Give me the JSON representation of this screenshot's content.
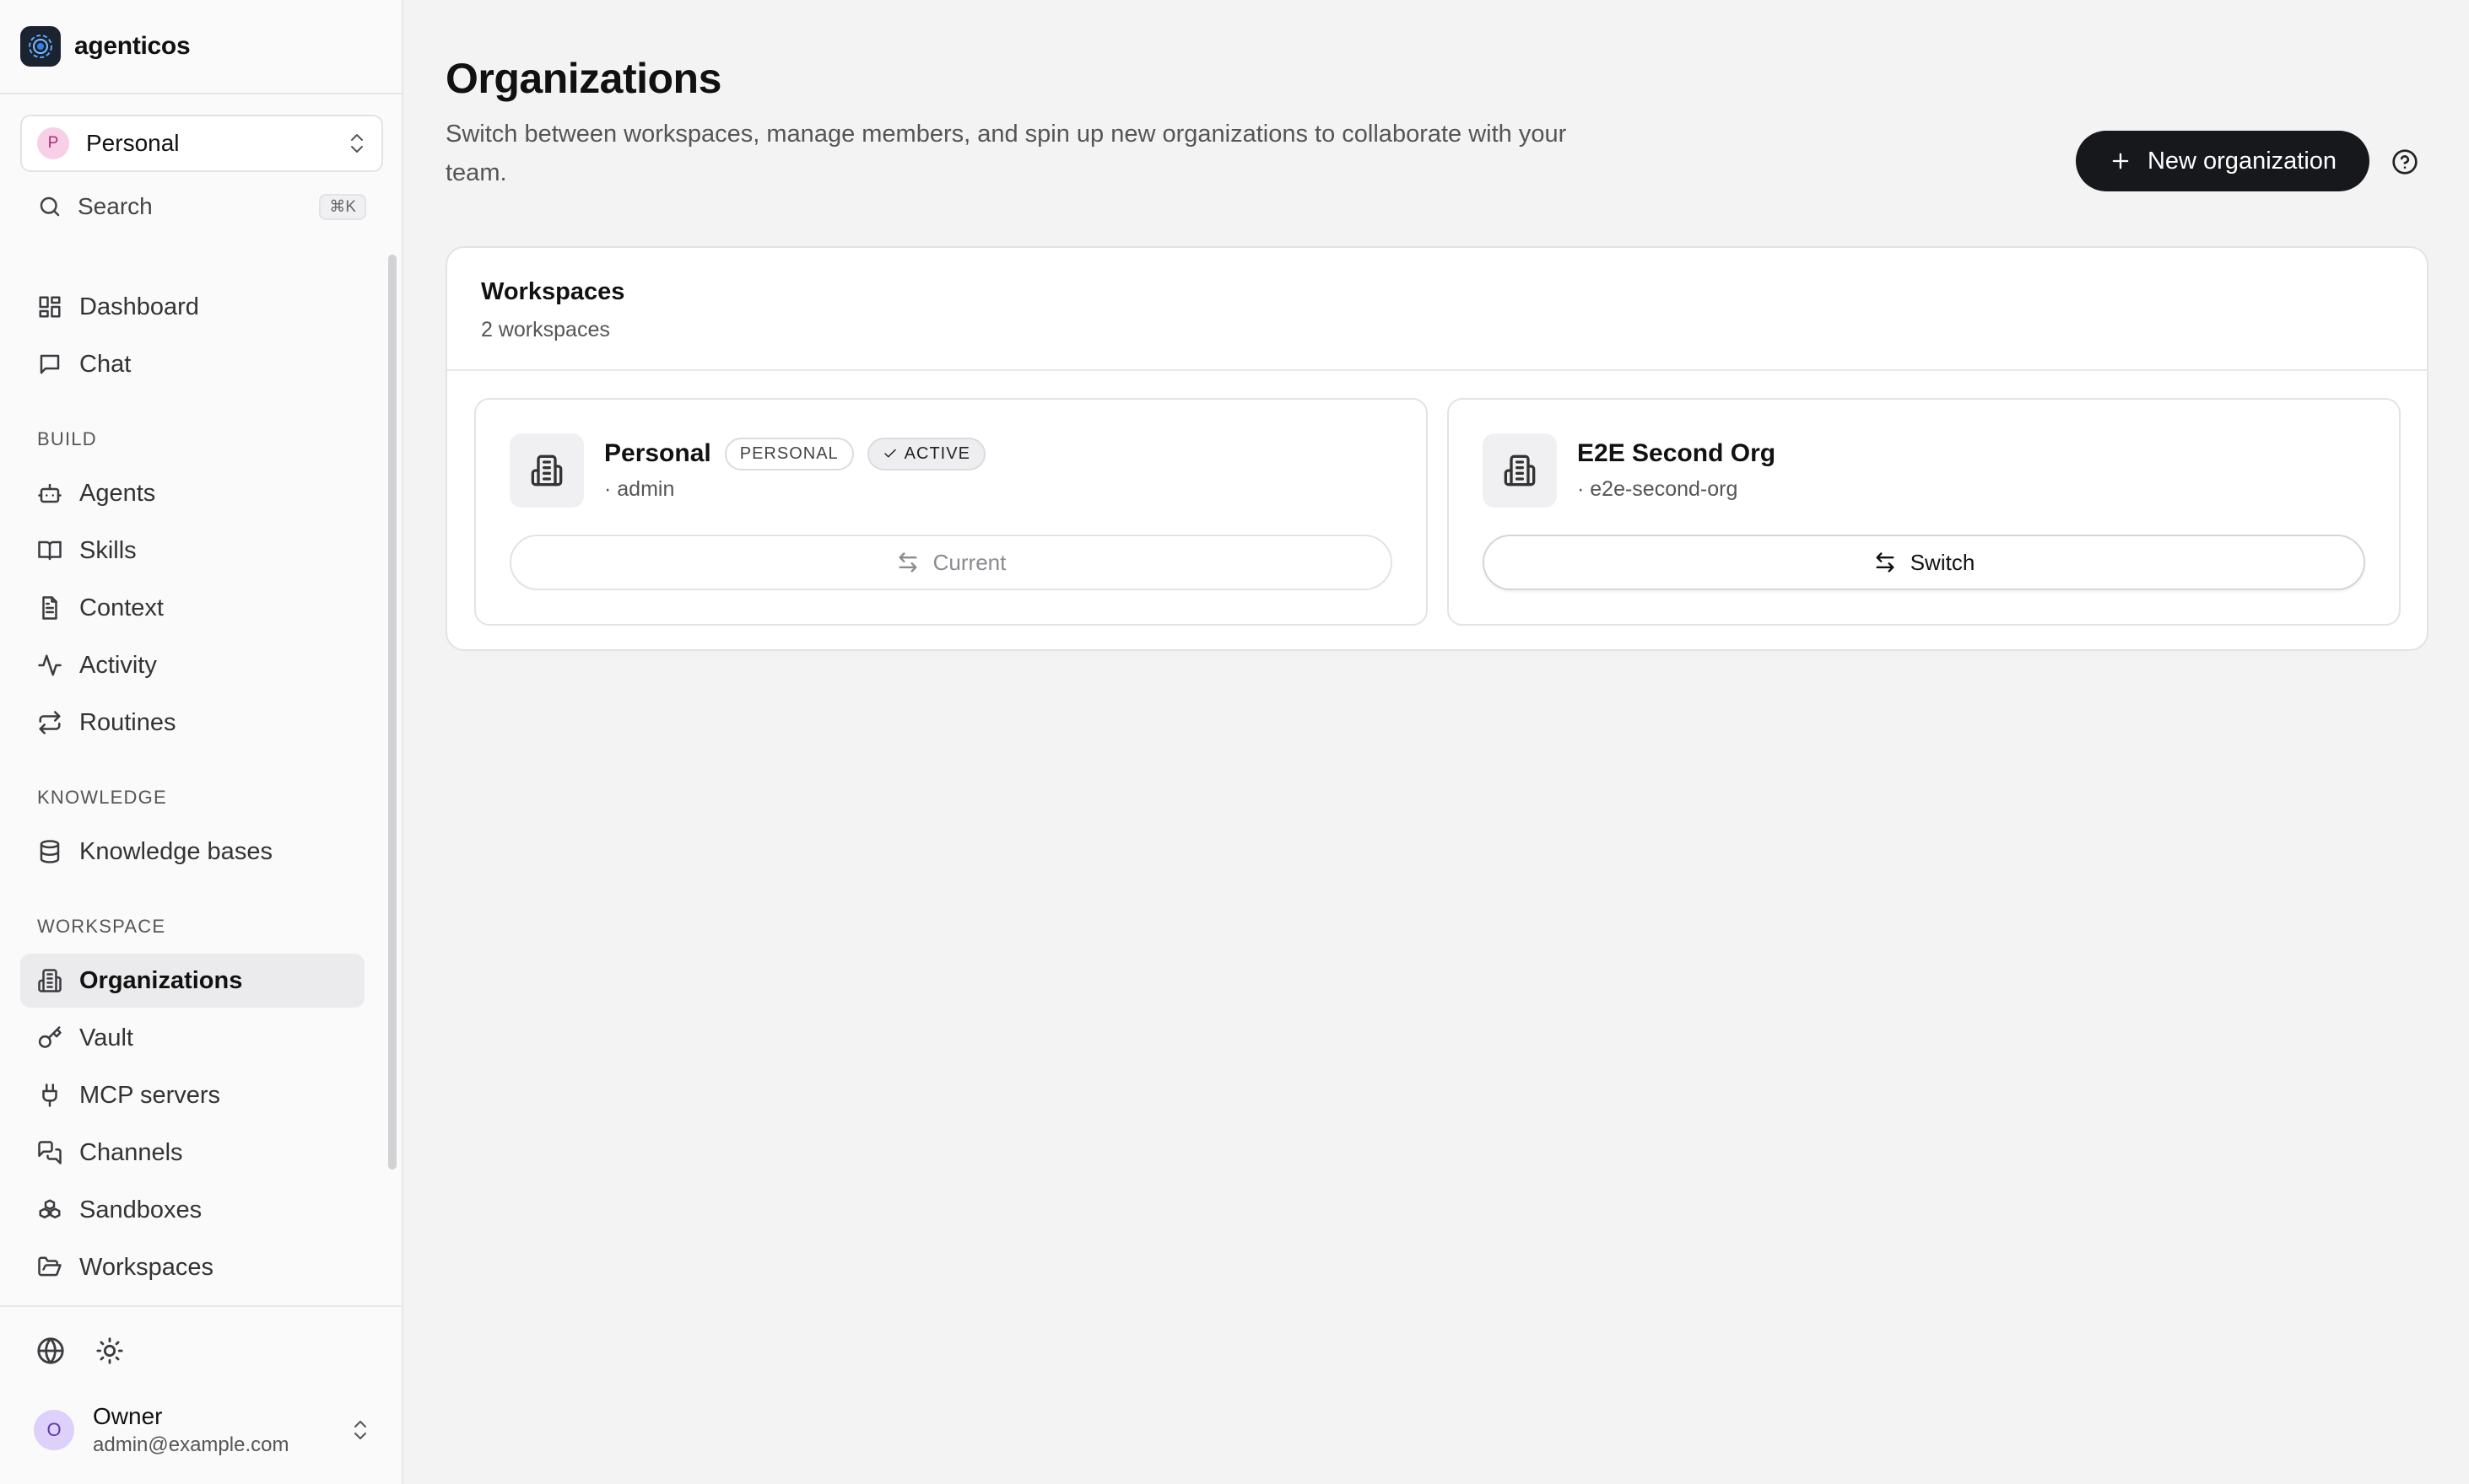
{
  "brand": {
    "name": "agenticos"
  },
  "org_switcher": {
    "avatar_letter": "P",
    "name": "Personal"
  },
  "search": {
    "label": "Search",
    "shortcut": "⌘K"
  },
  "nav": {
    "top": [
      {
        "label": "Dashboard",
        "icon": "dashboard-icon"
      },
      {
        "label": "Chat",
        "icon": "chat-icon"
      }
    ],
    "build_label": "BUILD",
    "build": [
      {
        "label": "Agents",
        "icon": "bot-icon"
      },
      {
        "label": "Skills",
        "icon": "book-icon"
      },
      {
        "label": "Context",
        "icon": "file-icon"
      },
      {
        "label": "Activity",
        "icon": "activity-icon"
      },
      {
        "label": "Routines",
        "icon": "repeat-icon"
      }
    ],
    "knowledge_label": "KNOWLEDGE",
    "knowledge": [
      {
        "label": "Knowledge bases",
        "icon": "database-icon"
      }
    ],
    "workspace_label": "WORKSPACE",
    "workspace": [
      {
        "label": "Organizations",
        "icon": "building-icon",
        "active": true
      },
      {
        "label": "Vault",
        "icon": "key-icon"
      },
      {
        "label": "MCP servers",
        "icon": "plug-icon"
      },
      {
        "label": "Channels",
        "icon": "messages-icon"
      },
      {
        "label": "Sandboxes",
        "icon": "boxes-icon"
      },
      {
        "label": "Workspaces",
        "icon": "folder-icon"
      }
    ]
  },
  "footer_tools": [
    "globe-icon",
    "sun-icon"
  ],
  "user": {
    "avatar_letter": "O",
    "name": "Owner",
    "email": "admin@example.com"
  },
  "page": {
    "title": "Organizations",
    "description": "Switch between workspaces, manage members, and spin up new organizations to collaborate with your team.",
    "new_button": "New organization"
  },
  "workspaces_card": {
    "title": "Workspaces",
    "subtitle": "2 workspaces",
    "items": [
      {
        "name": "Personal",
        "badges": [
          "PERSONAL",
          "ACTIVE"
        ],
        "meta": "· admin",
        "button": "Current",
        "is_current": true
      },
      {
        "name": "E2E Second Org",
        "badges": [],
        "meta": "· e2e-second-org",
        "button": "Switch",
        "is_current": false
      }
    ]
  }
}
